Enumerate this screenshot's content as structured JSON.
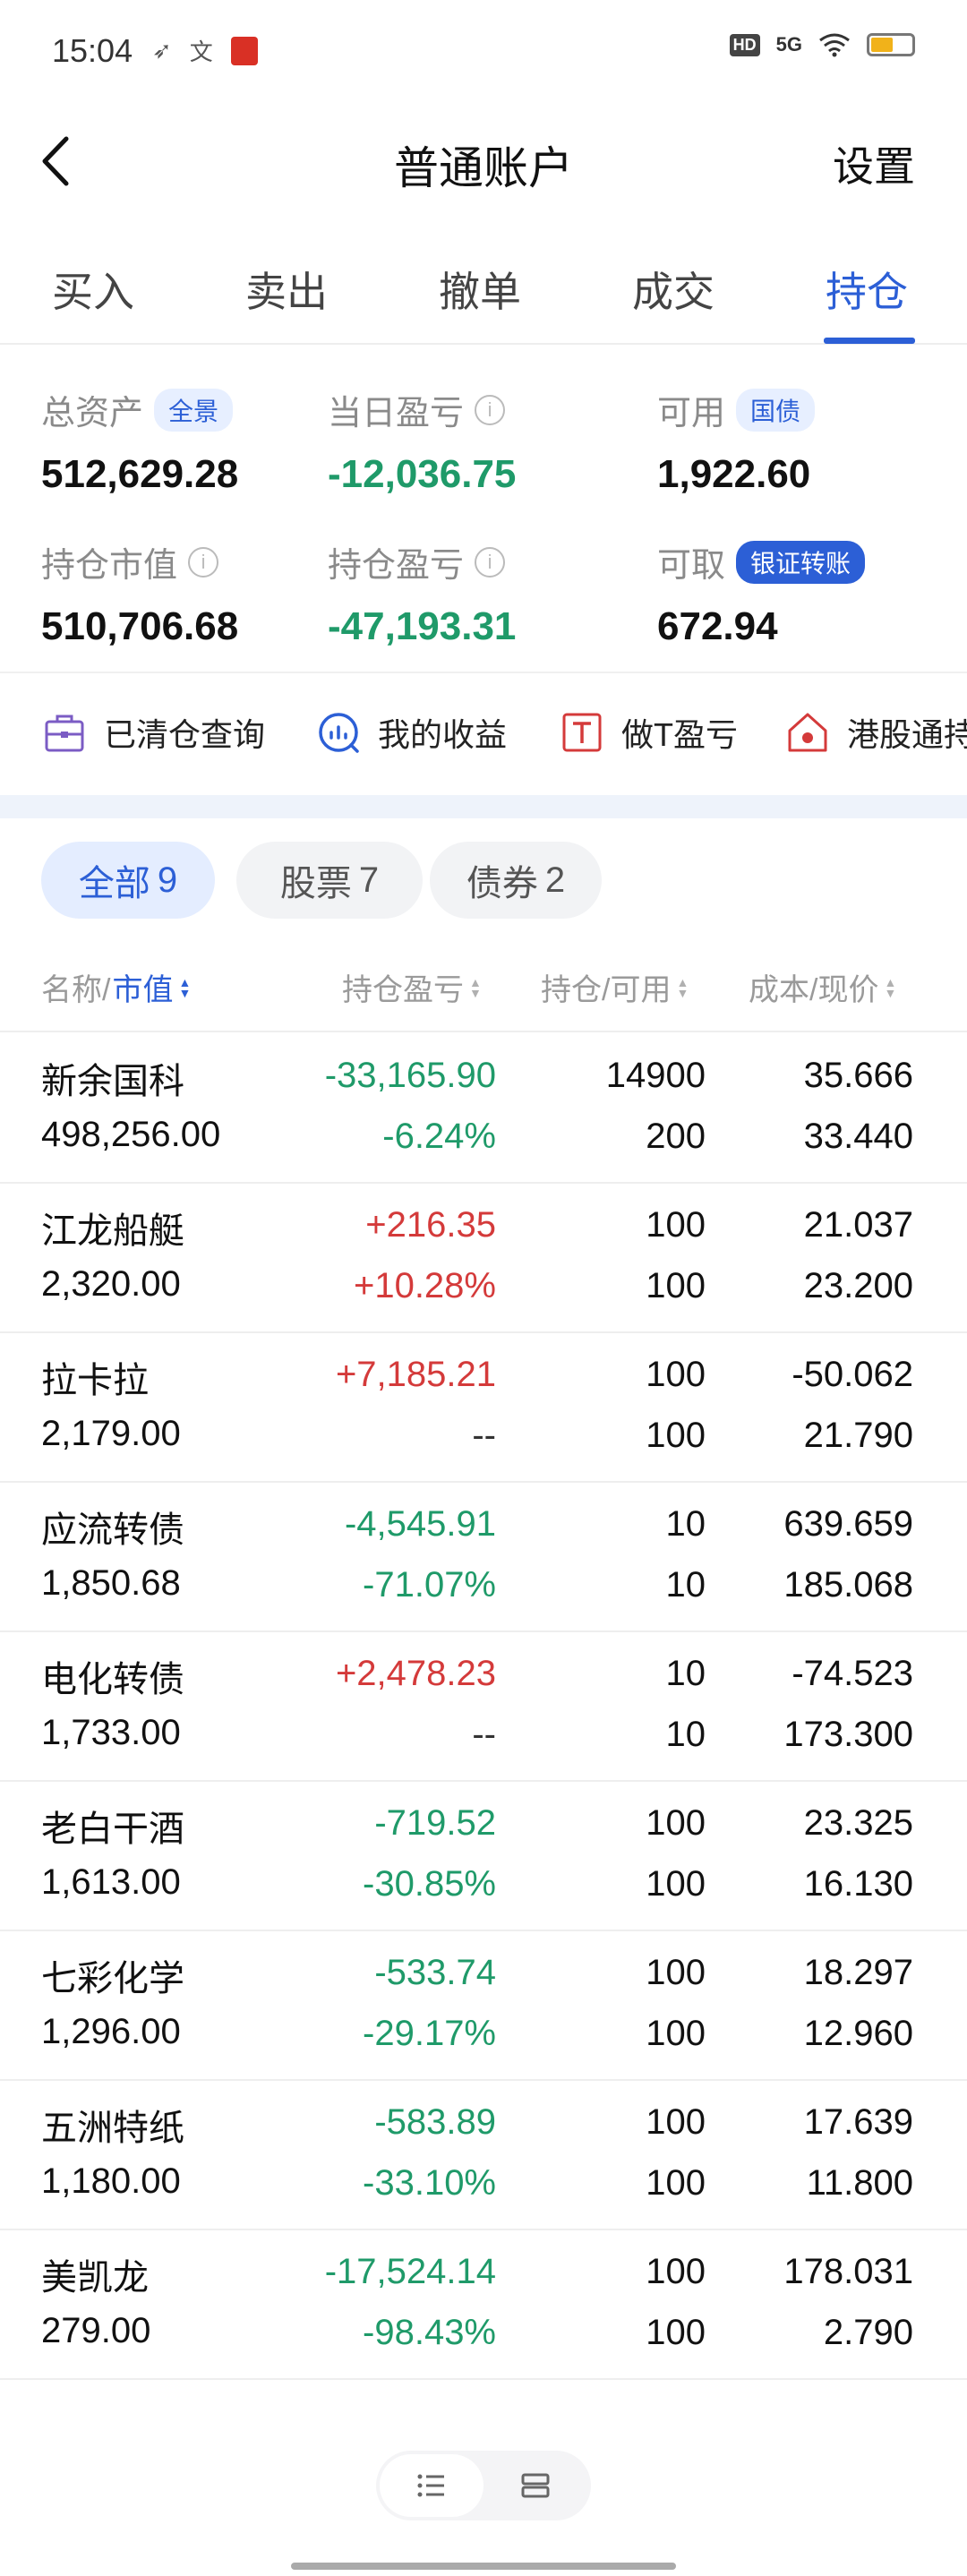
{
  "status_bar": {
    "time": "15:04",
    "network": "5G",
    "hd": "HD"
  },
  "nav": {
    "title": "普通账户",
    "settings_label": "设置"
  },
  "tabs": [
    {
      "label": "买入"
    },
    {
      "label": "卖出"
    },
    {
      "label": "撤单"
    },
    {
      "label": "成交"
    },
    {
      "label": "持仓",
      "active": true
    }
  ],
  "summary": {
    "total_assets_label": "总资产",
    "total_assets_pill": "全景",
    "total_assets": "512,629.28",
    "daily_pnl_label": "当日盈亏",
    "daily_pnl": "-12,036.75",
    "available_label": "可用",
    "available_pill": "国债",
    "available": "1,922.60",
    "market_value_label": "持仓市值",
    "market_value": "510,706.68",
    "position_pnl_label": "持仓盈亏",
    "position_pnl": "-47,193.31",
    "withdrawable_label": "可取",
    "withdrawable_pill": "银证转账",
    "withdrawable": "672.94"
  },
  "quick_links": [
    {
      "label": "已清仓查询",
      "icon": "briefcase-icon"
    },
    {
      "label": "我的收益",
      "icon": "chart-circle-icon"
    },
    {
      "label": "做T盈亏",
      "icon": "t-box-icon"
    },
    {
      "label": "港股通持",
      "icon": "hk-home-icon"
    }
  ],
  "filters": [
    {
      "label": "全部",
      "count": "9",
      "active": true
    },
    {
      "label": "股票",
      "count": "7"
    },
    {
      "label": "债券",
      "count": "2"
    }
  ],
  "table_header": {
    "name_prefix": "名称/",
    "name_sort": "市值",
    "pnl": "持仓盈亏",
    "position": "持仓/可用",
    "cost": "成本/现价"
  },
  "holdings": [
    {
      "name": "新余国科",
      "market_value": "498,256.00",
      "pnl": "-33,165.90",
      "pnl_pct": "-6.24%",
      "position": "14900",
      "available": "200",
      "cost": "35.666",
      "price": "33.440",
      "pnl_dir": "down",
      "pct_dir": "down"
    },
    {
      "name": "江龙船艇",
      "market_value": "2,320.00",
      "pnl": "+216.35",
      "pnl_pct": "+10.28%",
      "position": "100",
      "available": "100",
      "cost": "21.037",
      "price": "23.200",
      "pnl_dir": "up",
      "pct_dir": "up"
    },
    {
      "name": "拉卡拉",
      "market_value": "2,179.00",
      "pnl": "+7,185.21",
      "pnl_pct": "--",
      "position": "100",
      "available": "100",
      "cost": "-50.062",
      "price": "21.790",
      "pnl_dir": "up",
      "pct_dir": "none"
    },
    {
      "name": "应流转债",
      "market_value": "1,850.68",
      "pnl": "-4,545.91",
      "pnl_pct": "-71.07%",
      "position": "10",
      "available": "10",
      "cost": "639.659",
      "price": "185.068",
      "pnl_dir": "down",
      "pct_dir": "down"
    },
    {
      "name": "电化转债",
      "market_value": "1,733.00",
      "pnl": "+2,478.23",
      "pnl_pct": "--",
      "position": "10",
      "available": "10",
      "cost": "-74.523",
      "price": "173.300",
      "pnl_dir": "up",
      "pct_dir": "none"
    },
    {
      "name": "老白干酒",
      "market_value": "1,613.00",
      "pnl": "-719.52",
      "pnl_pct": "-30.85%",
      "position": "100",
      "available": "100",
      "cost": "23.325",
      "price": "16.130",
      "pnl_dir": "down",
      "pct_dir": "down"
    },
    {
      "name": "七彩化学",
      "market_value": "1,296.00",
      "pnl": "-533.74",
      "pnl_pct": "-29.17%",
      "position": "100",
      "available": "100",
      "cost": "18.297",
      "price": "12.960",
      "pnl_dir": "down",
      "pct_dir": "down"
    },
    {
      "name": "五洲特纸",
      "market_value": "1,180.00",
      "pnl": "-583.89",
      "pnl_pct": "-33.10%",
      "position": "100",
      "available": "100",
      "cost": "17.639",
      "price": "11.800",
      "pnl_dir": "down",
      "pct_dir": "down"
    },
    {
      "name": "美凯龙",
      "market_value": "279.00",
      "pnl": "-17,524.14",
      "pnl_pct": "-98.43%",
      "position": "100",
      "available": "100",
      "cost": "178.031",
      "price": "2.790",
      "pnl_dir": "down",
      "pct_dir": "down"
    }
  ],
  "colors": {
    "accent": "#2c5fd6",
    "gain": "#d43a3a",
    "loss": "#1f9a69"
  }
}
